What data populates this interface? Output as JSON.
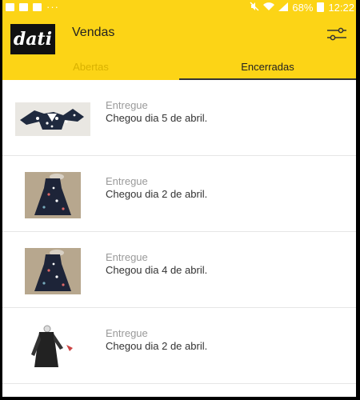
{
  "status_bar": {
    "battery": "68%",
    "time": "12:22",
    "dots": "···"
  },
  "app": {
    "logo_text": "dati",
    "title": "Vendas"
  },
  "tabs": [
    {
      "label": "Abertas",
      "active": false
    },
    {
      "label": "Encerradas",
      "active": true
    }
  ],
  "orders": [
    {
      "status": "Entregue",
      "date_text": "Chegou dia 5 de abril.",
      "thumb": "dress-flat-lay"
    },
    {
      "status": "Entregue",
      "date_text": "Chegou dia 2 de abril.",
      "thumb": "long-dress"
    },
    {
      "status": "Entregue",
      "date_text": "Chegou dia 4 de abril.",
      "thumb": "long-dress"
    },
    {
      "status": "Entregue",
      "date_text": "Chegou dia 2 de abril.",
      "thumb": "black-cardigan"
    }
  ],
  "colors": {
    "brand_yellow": "#fcd416",
    "inactive_tab": "#d9b200",
    "status_gray": "#9a9a9a"
  }
}
